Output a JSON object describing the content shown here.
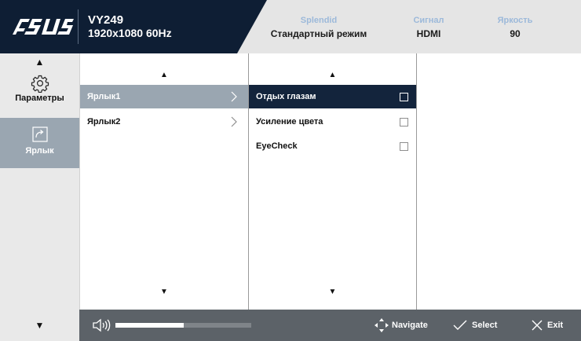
{
  "header": {
    "brand": "ASUS",
    "model": "VY249",
    "resolution": "1920x1080 60Hz",
    "splendid": {
      "label": "Splendid",
      "value": "Стандартный режим"
    },
    "signal": {
      "label": "Сигнал",
      "value": "HDMI"
    },
    "brightness": {
      "label": "Яркость",
      "value": "90"
    }
  },
  "nav": {
    "items": [
      {
        "label": "Параметры",
        "icon": "gear-icon",
        "active": false
      },
      {
        "label": "Ярлык",
        "icon": "shortcut-icon",
        "active": true
      }
    ]
  },
  "menu1": {
    "items": [
      {
        "label": "Ярлык1",
        "selected": true
      },
      {
        "label": "Ярлык2",
        "selected": false
      }
    ]
  },
  "menu2": {
    "items": [
      {
        "label": "Отдых глазам",
        "checked": false,
        "focused": true
      },
      {
        "label": "Усиление цвета",
        "checked": false,
        "focused": false
      },
      {
        "label": "EyeCheck",
        "checked": false,
        "focused": false
      }
    ]
  },
  "footer": {
    "volume_level": 0.5,
    "navigate": "Navigate",
    "select": "Select",
    "exit": "Exit"
  },
  "colors": {
    "header_dark": "#0e1e34",
    "highlight": "#9aa6b1",
    "focus": "#13243c",
    "footer": "#5c6268",
    "accent_label": "#9cb9da"
  }
}
